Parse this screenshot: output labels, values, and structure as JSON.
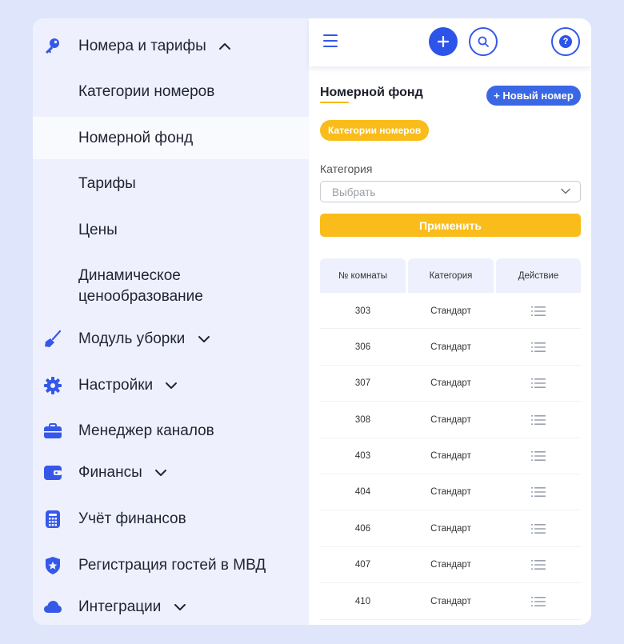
{
  "sidebar": {
    "items": [
      {
        "label": "Номера и тарифы",
        "icon": "key-icon",
        "expanded": true
      },
      {
        "label": "Категории номеров"
      },
      {
        "label": "Номерной фонд",
        "active": true
      },
      {
        "label": "Тарифы"
      },
      {
        "label": "Цены"
      },
      {
        "label": "Динамическое ценообразование"
      },
      {
        "label": "Модуль уборки",
        "icon": "broom-icon"
      },
      {
        "label": "Настройки",
        "icon": "gear-icon"
      },
      {
        "label": "Менеджер каналов",
        "icon": "briefcase-icon"
      },
      {
        "label": "Финансы",
        "icon": "wallet-icon"
      },
      {
        "label": "Учёт финансов",
        "icon": "calculator-icon"
      },
      {
        "label": "Регистрация гостей в МВД",
        "icon": "badge-icon"
      },
      {
        "label": "Интеграции",
        "icon": "cloud-icon"
      }
    ]
  },
  "topbar": {
    "menu_icon": "hamburger-icon",
    "add_icon": "plus-icon",
    "search_icon": "search-icon",
    "help_icon": "question-icon",
    "help_glyph": "?"
  },
  "main": {
    "title": "Номерной фонд",
    "new_button": "+ Новый номер",
    "chip": "Категории номеров",
    "category_label": "Категория",
    "select_placeholder": "Выбрать",
    "apply_button": "Применить"
  },
  "table": {
    "columns": [
      "№ комнаты",
      "Категория",
      "Действие"
    ],
    "rows": [
      {
        "room": "303",
        "category": "Стандарт"
      },
      {
        "room": "306",
        "category": "Стандарт"
      },
      {
        "room": "307",
        "category": "Стандарт"
      },
      {
        "room": "308",
        "category": "Стандарт"
      },
      {
        "room": "403",
        "category": "Стандарт"
      },
      {
        "room": "404",
        "category": "Стандарт"
      },
      {
        "room": "406",
        "category": "Стандарт"
      },
      {
        "room": "407",
        "category": "Стандарт"
      },
      {
        "room": "410",
        "category": "Стандарт"
      }
    ]
  },
  "colors": {
    "accent_blue": "#2d54e8",
    "accent_yellow": "#f9bc1a",
    "sidebar_bg": "#eef1fd",
    "page_bg": "#dfe6fb"
  }
}
